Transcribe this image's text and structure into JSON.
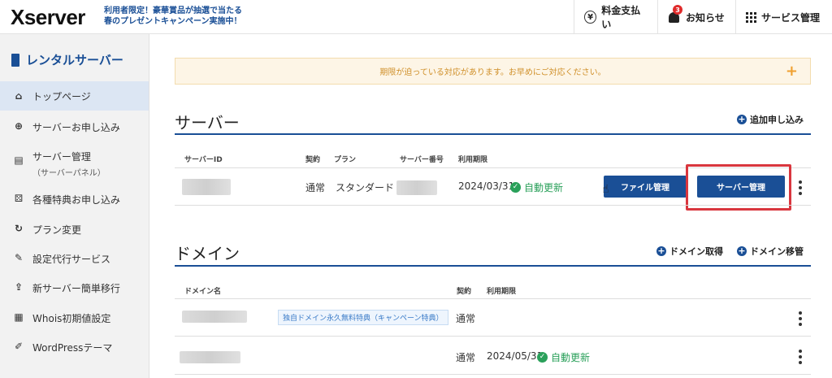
{
  "header": {
    "logo": "Xserver",
    "promo_line1": "利用者限定！豪華賞品が抽選で当たる",
    "promo_line2": "春のプレゼントキャンペーン実施中！",
    "pay_label": "料金支払い",
    "news_label": "お知らせ",
    "news_badge": "3",
    "service_label": "サービス管理"
  },
  "sidebar": {
    "title": "レンタルサーバー",
    "items": [
      {
        "label": "トップページ"
      },
      {
        "label": "サーバーお申し込み"
      },
      {
        "label": "サーバー管理",
        "sub": "（サーバーパネル）"
      },
      {
        "label": "各種特典お申し込み"
      },
      {
        "label": "プラン変更"
      },
      {
        "label": "設定代行サービス"
      },
      {
        "label": "新サーバー簡単移行"
      },
      {
        "label": "Whois初期値設定"
      },
      {
        "label": "WordPressテーマ"
      }
    ]
  },
  "alert": {
    "text": "期限が迫っている対応があります。お早めにご対応ください。",
    "plus": "+"
  },
  "server_section": {
    "title": "サーバー",
    "add_label": "追加申し込み",
    "columns": [
      "サーバーID",
      "契約",
      "プラン",
      "サーバー番号",
      "利用期限"
    ],
    "row": {
      "contract": "通常",
      "plan": "スタンダード",
      "expiry": "2024/03/31",
      "auto_renew": "自動更新",
      "file_button": "ファイル管理",
      "server_button": "サーバー管理"
    }
  },
  "domain_section": {
    "title": "ドメイン",
    "acquire_label": "ドメイン取得",
    "transfer_label": "ドメイン移管",
    "columns": [
      "ドメイン名",
      "契約",
      "利用期限"
    ],
    "rows": [
      {
        "tag": "独自ドメイン永久無料特典（キャンペーン特典）",
        "contract": "通常",
        "expiry": "",
        "auto_renew": ""
      },
      {
        "tag": "",
        "contract": "通常",
        "expiry": "2024/05/31",
        "auto_renew": "自動更新"
      }
    ]
  },
  "colors": {
    "brand_blue": "#1a4f96",
    "highlight_red": "#d9363e",
    "renew_green": "#2aa05a",
    "alert_orange": "#d0902a"
  }
}
